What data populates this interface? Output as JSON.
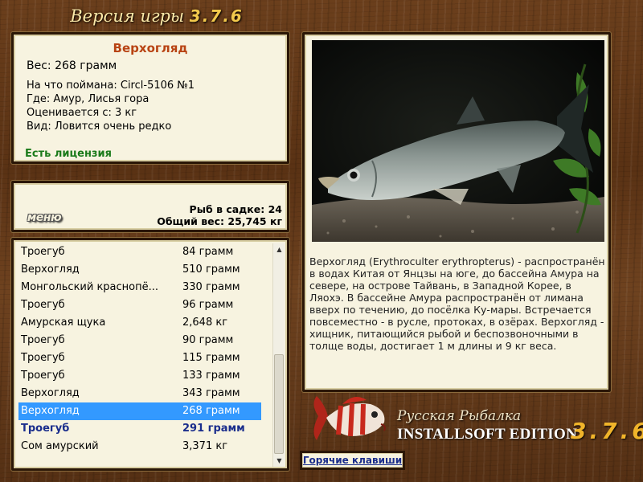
{
  "header": {
    "title": "Версия игры",
    "version": "3.7.6"
  },
  "info": {
    "fish_name": "Верхогляд",
    "weight": "Вес: 268 грамм",
    "caught_on": "На что поймана: Circl-5106 №1",
    "location": "Где: Амур, Лисья гора",
    "valued_from": "Оценивается с: 3 кг",
    "kind": "Вид: Ловится очень редко",
    "license": "Есть лицензия"
  },
  "cage": {
    "menu_label": "меню",
    "fish_count": "Рыб в садке: 24",
    "total_weight": "Общий вес: 25,745 кг"
  },
  "catch_list": [
    {
      "name": "Троегуб",
      "weight": "84 грамм"
    },
    {
      "name": "Верхогляд",
      "weight": "510 грамм"
    },
    {
      "name": "Монгольский краснопё...",
      "weight": "330 грамм"
    },
    {
      "name": "Троегуб",
      "weight": "96 грамм"
    },
    {
      "name": "Амурская щука",
      "weight": "2,648 кг"
    },
    {
      "name": "Троегуб",
      "weight": "90 грамм"
    },
    {
      "name": "Троегуб",
      "weight": "115 грамм"
    },
    {
      "name": "Троегуб",
      "weight": "133 грамм"
    },
    {
      "name": "Верхогляд",
      "weight": "343 грамм"
    },
    {
      "name": "Верхогляд",
      "weight": "268 грамм"
    },
    {
      "name": "Троегуб",
      "weight": "291 грамм"
    },
    {
      "name": "Сом амурский",
      "weight": "3,371 кг"
    }
  ],
  "description": "Верхогляд (Erythroculter erythropterus) - распространён в водах Китая от Янцзы на юге, до бассейна Амура на севере, на острове Тайвань, в Западной Корее, в Ляохэ. В бассейне Амура распространён от лимана вверх по течению, до посёлка Ку-мары. Встречается повсеместно - в русле, протоках, в озёрах. Верхогляд - хищник, питающийся рыбой и беспозвоночными в толще воды, достигает 1 м длины и 9 кг веса.",
  "logo": {
    "title": "Русская Рыбалка",
    "edition": "INSTALLSOFT EDITION",
    "version": "3.7.6"
  },
  "hotkeys_label": "Горячие клавиши",
  "colors": {
    "fish_name": "#b84313",
    "license": "#1a7a1a",
    "selected_row": "#3399ff",
    "highlight_row": "#1a2d8c",
    "version": "#f0b42a"
  }
}
